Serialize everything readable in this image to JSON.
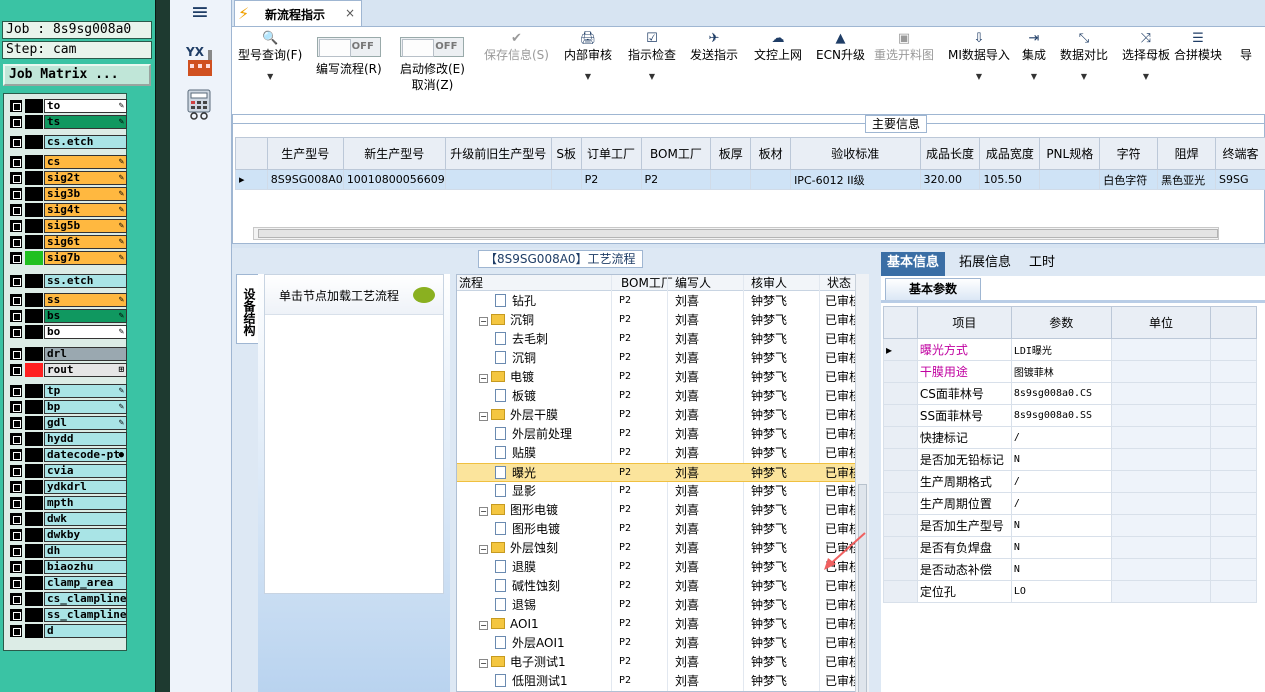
{
  "job_matrix": {
    "job": "Job : 8s9sg008a0",
    "step": "Step: cam",
    "button": "Job Matrix ...",
    "layers": [
      {
        "name": "to",
        "bg": "#ffffff",
        "swatch": "#000000",
        "pen": "✎"
      },
      {
        "name": "ts",
        "bg": "#109860",
        "swatch": "#000000",
        "pen": "✎"
      },
      {
        "name": "cs.etch",
        "bg": "#a9e4e6",
        "swatch": "#000000",
        "pen": ""
      },
      {
        "name": "cs",
        "bg": "#ffb840",
        "swatch": "#000000",
        "pen": "✎"
      },
      {
        "name": "sig2t",
        "bg": "#ffb840",
        "swatch": "#000000",
        "pen": "✎"
      },
      {
        "name": "sig3b",
        "bg": "#ffb840",
        "swatch": "#000000",
        "pen": "✎"
      },
      {
        "name": "sig4t",
        "bg": "#ffb840",
        "swatch": "#000000",
        "pen": "✎"
      },
      {
        "name": "sig5b",
        "bg": "#ffb840",
        "swatch": "#000000",
        "pen": "✎"
      },
      {
        "name": "sig6t",
        "bg": "#ffb840",
        "swatch": "#000000",
        "pen": "✎"
      },
      {
        "name": "sig7b",
        "bg": "#ffb840",
        "swatch": "#20c020",
        "pen": "✎"
      },
      {
        "name": "ss.etch",
        "bg": "#a9e4e6",
        "swatch": "#000000",
        "pen": ""
      },
      {
        "name": "ss",
        "bg": "#ffb840",
        "swatch": "#000000",
        "pen": "✎"
      },
      {
        "name": "bs",
        "bg": "#109860",
        "swatch": "#000000",
        "pen": "✎"
      },
      {
        "name": "bo",
        "bg": "#ffffff",
        "swatch": "#000000",
        "pen": "✎"
      },
      {
        "name": "drl",
        "bg": "#9aa8b0",
        "swatch": "#000000",
        "pen": ""
      },
      {
        "name": "rout",
        "bg": "#e6e6e6",
        "swatch": "#ff2020",
        "pen": "⊞"
      },
      {
        "name": "tp",
        "bg": "#a9e4e6",
        "swatch": "#000000",
        "pen": "✎"
      },
      {
        "name": "bp",
        "bg": "#a9e4e6",
        "swatch": "#000000",
        "pen": "✎"
      },
      {
        "name": "gdl",
        "bg": "#a9e4e6",
        "swatch": "#000000",
        "pen": "✎"
      },
      {
        "name": "hydd",
        "bg": "#a9e4e6",
        "swatch": "#000000",
        "pen": ""
      },
      {
        "name": "datecode-pt",
        "bg": "#a9e4e6",
        "swatch": "#000000",
        "pen": "●"
      },
      {
        "name": "cvia",
        "bg": "#a9e4e6",
        "swatch": "#000000",
        "pen": ""
      },
      {
        "name": "ydkdrl",
        "bg": "#a9e4e6",
        "swatch": "#000000",
        "pen": ""
      },
      {
        "name": "mpth",
        "bg": "#a9e4e6",
        "swatch": "#000000",
        "pen": ""
      },
      {
        "name": "dwk",
        "bg": "#a9e4e6",
        "swatch": "#000000",
        "pen": ""
      },
      {
        "name": "dwkby",
        "bg": "#a9e4e6",
        "swatch": "#000000",
        "pen": ""
      },
      {
        "name": "dh",
        "bg": "#a9e4e6",
        "swatch": "#000000",
        "pen": ""
      },
      {
        "name": "biaozhu",
        "bg": "#a9e4e6",
        "swatch": "#000000",
        "pen": ""
      },
      {
        "name": "clamp_area",
        "bg": "#a9e4e6",
        "swatch": "#000000",
        "pen": ""
      },
      {
        "name": "cs_clampline",
        "bg": "#a9e4e6",
        "swatch": "#000000",
        "pen": ""
      },
      {
        "name": "ss_clampline",
        "bg": "#a9e4e6",
        "swatch": "#000000",
        "pen": ""
      },
      {
        "name": "d",
        "bg": "#a9e4e6",
        "swatch": "#000000",
        "pen": ""
      }
    ]
  },
  "sidebar": {
    "menu_icon": "≡",
    "app_icon": "yx-factory-icon",
    "calc_icon": "calculator-icon",
    "yx_text": "YX"
  },
  "tab": {
    "icon": "⚡",
    "label": "新流程指示",
    "close": "×"
  },
  "toolbar": {
    "buttons": [
      {
        "icon": "🔍",
        "label": "型号查询(F)",
        "arrow": "▼",
        "disabled": false
      },
      {
        "toggle": "OFF",
        "label": "编写流程(R)"
      },
      {
        "toggle": "OFF",
        "label": "启动修改(E)",
        "label2": "取消(Z)"
      },
      {
        "icon": "✔",
        "label": "保存信息(S)",
        "disabled": true
      },
      {
        "icon": "🖨",
        "label": "内部审核",
        "arrow": "▼",
        "disabled": false
      },
      {
        "icon": "☑",
        "label": "指示检查",
        "arrow": "▼",
        "disabled": false
      },
      {
        "icon": "✈",
        "label": "发送指示",
        "disabled": false
      },
      {
        "icon": "☁",
        "label": "文控上网",
        "disabled": false
      },
      {
        "icon": "▲",
        "label": "ECN升级",
        "disabled": false
      },
      {
        "icon": "▣",
        "label": "重选开料图",
        "disabled": true
      },
      {
        "icon": "⇩",
        "label": "MI数据导入",
        "arrow": "▼",
        "disabled": false
      },
      {
        "icon": "⇥",
        "label": "集成",
        "arrow": "▼",
        "disabled": false
      },
      {
        "icon": "⤡",
        "label": "数据对比",
        "arrow": "▼",
        "disabled": false
      },
      {
        "icon": "⤨",
        "label": "选择母板",
        "arrow": "▼",
        "disabled": false
      },
      {
        "icon": "☰",
        "label": "合拼模块",
        "disabled": false
      },
      {
        "icon": "",
        "label": "导",
        "disabled": false
      }
    ]
  },
  "main_info": {
    "title": "主要信息",
    "columns": [
      "生产型号",
      "新生产型号",
      "升级前旧生产型号",
      "S板",
      "订单工厂",
      "BOM工厂",
      "板厚",
      "板材",
      "验收标准",
      "成品长度",
      "成品宽度",
      "PNL规格",
      "字符",
      "阻焊",
      "终端客"
    ],
    "row": [
      "8S9SG008A0",
      "10010800056609",
      "",
      "",
      "P2",
      "P2",
      "",
      "",
      "IPC-6012 II级",
      "320.00",
      "105.50",
      "",
      "白色字符",
      "黑色亚光",
      "S9SG"
    ]
  },
  "process": {
    "title": "【8S9SG008A0】工艺流程",
    "side_tab": "设备结构",
    "struct_hint": "单击节点加载工艺流程",
    "columns": [
      "流程",
      "BOM工厂",
      "编写人",
      "核审人",
      "状态"
    ],
    "rows": [
      {
        "name": "钻孔",
        "level": 2,
        "folder": false,
        "bom": "P2",
        "writer": "刘喜",
        "reviewer": "钟梦飞",
        "status": "已审核",
        "sel": false
      },
      {
        "name": "沉铜",
        "level": 1,
        "folder": true,
        "bom": "P2",
        "writer": "刘喜",
        "reviewer": "钟梦飞",
        "status": "已审核",
        "sel": false
      },
      {
        "name": "去毛刺",
        "level": 2,
        "folder": false,
        "bom": "P2",
        "writer": "刘喜",
        "reviewer": "钟梦飞",
        "status": "已审核",
        "sel": false
      },
      {
        "name": "沉铜",
        "level": 2,
        "folder": false,
        "bom": "P2",
        "writer": "刘喜",
        "reviewer": "钟梦飞",
        "status": "已审核",
        "sel": false
      },
      {
        "name": "电镀",
        "level": 1,
        "folder": true,
        "bom": "P2",
        "writer": "刘喜",
        "reviewer": "钟梦飞",
        "status": "已审核",
        "sel": false
      },
      {
        "name": "板镀",
        "level": 2,
        "folder": false,
        "bom": "P2",
        "writer": "刘喜",
        "reviewer": "钟梦飞",
        "status": "已审核",
        "sel": false
      },
      {
        "name": "外层干膜",
        "level": 1,
        "folder": true,
        "bom": "P2",
        "writer": "刘喜",
        "reviewer": "钟梦飞",
        "status": "已审核",
        "sel": false
      },
      {
        "name": "外层前处理",
        "level": 2,
        "folder": false,
        "bom": "P2",
        "writer": "刘喜",
        "reviewer": "钟梦飞",
        "status": "已审核",
        "sel": false
      },
      {
        "name": "贴膜",
        "level": 2,
        "folder": false,
        "bom": "P2",
        "writer": "刘喜",
        "reviewer": "钟梦飞",
        "status": "已审核",
        "sel": false
      },
      {
        "name": "曝光",
        "level": 2,
        "folder": false,
        "bom": "P2",
        "writer": "刘喜",
        "reviewer": "钟梦飞",
        "status": "已审核",
        "sel": true
      },
      {
        "name": "显影",
        "level": 2,
        "folder": false,
        "bom": "P2",
        "writer": "刘喜",
        "reviewer": "钟梦飞",
        "status": "已审核",
        "sel": false
      },
      {
        "name": "图形电镀",
        "level": 1,
        "folder": true,
        "bom": "P2",
        "writer": "刘喜",
        "reviewer": "钟梦飞",
        "status": "已审核",
        "sel": false
      },
      {
        "name": "图形电镀",
        "level": 2,
        "folder": false,
        "bom": "P2",
        "writer": "刘喜",
        "reviewer": "钟梦飞",
        "status": "已审核",
        "sel": false
      },
      {
        "name": "外层蚀刻",
        "level": 1,
        "folder": true,
        "bom": "P2",
        "writer": "刘喜",
        "reviewer": "钟梦飞",
        "status": "已审核",
        "sel": false
      },
      {
        "name": "退膜",
        "level": 2,
        "folder": false,
        "bom": "P2",
        "writer": "刘喜",
        "reviewer": "钟梦飞",
        "status": "已审核",
        "sel": false
      },
      {
        "name": "碱性蚀刻",
        "level": 2,
        "folder": false,
        "bom": "P2",
        "writer": "刘喜",
        "reviewer": "钟梦飞",
        "status": "已审核",
        "sel": false
      },
      {
        "name": "退锡",
        "level": 2,
        "folder": false,
        "bom": "P2",
        "writer": "刘喜",
        "reviewer": "钟梦飞",
        "status": "已审核",
        "sel": false
      },
      {
        "name": "AOI1",
        "level": 1,
        "folder": true,
        "bom": "P2",
        "writer": "刘喜",
        "reviewer": "钟梦飞",
        "status": "已审核",
        "sel": false
      },
      {
        "name": "外层AOI1",
        "level": 2,
        "folder": false,
        "bom": "P2",
        "writer": "刘喜",
        "reviewer": "钟梦飞",
        "status": "已审核",
        "sel": false
      },
      {
        "name": "电子测试1",
        "level": 1,
        "folder": true,
        "bom": "P2",
        "writer": "刘喜",
        "reviewer": "钟梦飞",
        "status": "已审核",
        "sel": false
      },
      {
        "name": "低阻测试1",
        "level": 2,
        "folder": false,
        "bom": "P2",
        "writer": "刘喜",
        "reviewer": "钟梦飞",
        "status": "已审核",
        "sel": false
      }
    ]
  },
  "right_panel": {
    "tabs": [
      "基本信息",
      "拓展信息",
      "工时"
    ],
    "sub_tab": "基本参数",
    "columns": [
      "项目",
      "参数",
      "单位"
    ],
    "rows": [
      {
        "item": "曝光方式",
        "value": "LDI曝光",
        "unit": "",
        "highlight": true,
        "current": true
      },
      {
        "item": "干膜用途",
        "value": "图镀菲林",
        "unit": "",
        "highlight": true,
        "current": false
      },
      {
        "item": "CS面菲林号",
        "value": "8s9sg008a0.CS",
        "unit": "",
        "highlight": false,
        "current": false
      },
      {
        "item": "SS面菲林号",
        "value": "8s9sg008a0.SS",
        "unit": "",
        "highlight": false,
        "current": false
      },
      {
        "item": "快捷标记",
        "value": "/",
        "unit": "",
        "highlight": false,
        "current": false
      },
      {
        "item": "是否加无铅标记",
        "value": "N",
        "unit": "",
        "highlight": false,
        "current": false
      },
      {
        "item": "生产周期格式",
        "value": "/",
        "unit": "",
        "highlight": false,
        "current": false
      },
      {
        "item": "生产周期位置",
        "value": "/",
        "unit": "",
        "highlight": false,
        "current": false
      },
      {
        "item": "是否加生产型号",
        "value": "N",
        "unit": "",
        "highlight": false,
        "current": false
      },
      {
        "item": "是否有负焊盘",
        "value": "N",
        "unit": "",
        "highlight": false,
        "current": false
      },
      {
        "item": "是否动态补偿",
        "value": "N",
        "unit": "",
        "highlight": false,
        "current": false
      },
      {
        "item": "定位孔",
        "value": "LO",
        "unit": "",
        "highlight": false,
        "current": false
      }
    ]
  },
  "colors": {
    "accent": "#3a6ea5",
    "selected_row": "#fbe49c",
    "annotation_arrow": "#f06060"
  }
}
